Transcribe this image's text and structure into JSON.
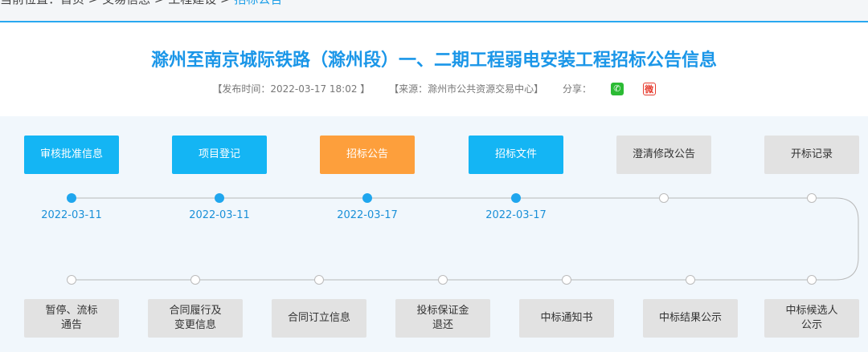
{
  "breadcrumb": {
    "text": "当前位置：首页 > 交易信息 > 工程建设 > ",
    "current": "招标公告"
  },
  "title": "滁州至南京城际铁路（滁州段）一、二期工程弱电安装工程招标公告信息",
  "meta": {
    "publish_time": "【发布时间：2022-03-17 18:02 】",
    "source": "【来源：滁州市公共资源交易中心】",
    "share_label": "分享：",
    "weibo_glyph": "微"
  },
  "top_steps": [
    {
      "label": "审核批准信息",
      "state": "done",
      "date": "2022-03-11"
    },
    {
      "label": "项目登记",
      "state": "done",
      "date": "2022-03-11"
    },
    {
      "label": "招标公告",
      "state": "cur",
      "date": "2022-03-17"
    },
    {
      "label": "招标文件",
      "state": "done",
      "date": "2022-03-17"
    },
    {
      "label": "澄清修改公告",
      "state": "todo",
      "date": ""
    },
    {
      "label": "开标记录",
      "state": "todo",
      "date": ""
    }
  ],
  "bottom_steps": [
    {
      "label": "暂停、流标\n通告"
    },
    {
      "label": "合同履行及\n变更信息"
    },
    {
      "label": "合同订立信息"
    },
    {
      "label": "投标保证金\n退还"
    },
    {
      "label": "中标通知书"
    },
    {
      "label": "中标结果公示"
    },
    {
      "label": "中标候选人\n公示"
    }
  ],
  "colors": {
    "done": "#14b5f4",
    "current": "#fd9f3c",
    "todo": "#e2e2e2",
    "title": "#1a96e8"
  }
}
